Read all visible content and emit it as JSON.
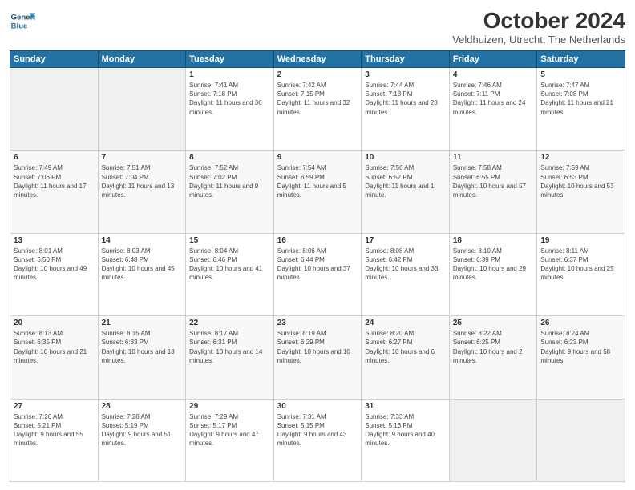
{
  "header": {
    "logo_line1": "General",
    "logo_line2": "Blue",
    "month": "October 2024",
    "location": "Veldhuizen, Utrecht, The Netherlands"
  },
  "weekdays": [
    "Sunday",
    "Monday",
    "Tuesday",
    "Wednesday",
    "Thursday",
    "Friday",
    "Saturday"
  ],
  "weeks": [
    [
      {
        "day": "",
        "sunrise": "",
        "sunset": "",
        "daylight": ""
      },
      {
        "day": "",
        "sunrise": "",
        "sunset": "",
        "daylight": ""
      },
      {
        "day": "1",
        "sunrise": "Sunrise: 7:41 AM",
        "sunset": "Sunset: 7:18 PM",
        "daylight": "Daylight: 11 hours and 36 minutes."
      },
      {
        "day": "2",
        "sunrise": "Sunrise: 7:42 AM",
        "sunset": "Sunset: 7:15 PM",
        "daylight": "Daylight: 11 hours and 32 minutes."
      },
      {
        "day": "3",
        "sunrise": "Sunrise: 7:44 AM",
        "sunset": "Sunset: 7:13 PM",
        "daylight": "Daylight: 11 hours and 28 minutes."
      },
      {
        "day": "4",
        "sunrise": "Sunrise: 7:46 AM",
        "sunset": "Sunset: 7:11 PM",
        "daylight": "Daylight: 11 hours and 24 minutes."
      },
      {
        "day": "5",
        "sunrise": "Sunrise: 7:47 AM",
        "sunset": "Sunset: 7:08 PM",
        "daylight": "Daylight: 11 hours and 21 minutes."
      }
    ],
    [
      {
        "day": "6",
        "sunrise": "Sunrise: 7:49 AM",
        "sunset": "Sunset: 7:06 PM",
        "daylight": "Daylight: 11 hours and 17 minutes."
      },
      {
        "day": "7",
        "sunrise": "Sunrise: 7:51 AM",
        "sunset": "Sunset: 7:04 PM",
        "daylight": "Daylight: 11 hours and 13 minutes."
      },
      {
        "day": "8",
        "sunrise": "Sunrise: 7:52 AM",
        "sunset": "Sunset: 7:02 PM",
        "daylight": "Daylight: 11 hours and 9 minutes."
      },
      {
        "day": "9",
        "sunrise": "Sunrise: 7:54 AM",
        "sunset": "Sunset: 6:59 PM",
        "daylight": "Daylight: 11 hours and 5 minutes."
      },
      {
        "day": "10",
        "sunrise": "Sunrise: 7:56 AM",
        "sunset": "Sunset: 6:57 PM",
        "daylight": "Daylight: 11 hours and 1 minute."
      },
      {
        "day": "11",
        "sunrise": "Sunrise: 7:58 AM",
        "sunset": "Sunset: 6:55 PM",
        "daylight": "Daylight: 10 hours and 57 minutes."
      },
      {
        "day": "12",
        "sunrise": "Sunrise: 7:59 AM",
        "sunset": "Sunset: 6:53 PM",
        "daylight": "Daylight: 10 hours and 53 minutes."
      }
    ],
    [
      {
        "day": "13",
        "sunrise": "Sunrise: 8:01 AM",
        "sunset": "Sunset: 6:50 PM",
        "daylight": "Daylight: 10 hours and 49 minutes."
      },
      {
        "day": "14",
        "sunrise": "Sunrise: 8:03 AM",
        "sunset": "Sunset: 6:48 PM",
        "daylight": "Daylight: 10 hours and 45 minutes."
      },
      {
        "day": "15",
        "sunrise": "Sunrise: 8:04 AM",
        "sunset": "Sunset: 6:46 PM",
        "daylight": "Daylight: 10 hours and 41 minutes."
      },
      {
        "day": "16",
        "sunrise": "Sunrise: 8:06 AM",
        "sunset": "Sunset: 6:44 PM",
        "daylight": "Daylight: 10 hours and 37 minutes."
      },
      {
        "day": "17",
        "sunrise": "Sunrise: 8:08 AM",
        "sunset": "Sunset: 6:42 PM",
        "daylight": "Daylight: 10 hours and 33 minutes."
      },
      {
        "day": "18",
        "sunrise": "Sunrise: 8:10 AM",
        "sunset": "Sunset: 6:39 PM",
        "daylight": "Daylight: 10 hours and 29 minutes."
      },
      {
        "day": "19",
        "sunrise": "Sunrise: 8:11 AM",
        "sunset": "Sunset: 6:37 PM",
        "daylight": "Daylight: 10 hours and 25 minutes."
      }
    ],
    [
      {
        "day": "20",
        "sunrise": "Sunrise: 8:13 AM",
        "sunset": "Sunset: 6:35 PM",
        "daylight": "Daylight: 10 hours and 21 minutes."
      },
      {
        "day": "21",
        "sunrise": "Sunrise: 8:15 AM",
        "sunset": "Sunset: 6:33 PM",
        "daylight": "Daylight: 10 hours and 18 minutes."
      },
      {
        "day": "22",
        "sunrise": "Sunrise: 8:17 AM",
        "sunset": "Sunset: 6:31 PM",
        "daylight": "Daylight: 10 hours and 14 minutes."
      },
      {
        "day": "23",
        "sunrise": "Sunrise: 8:19 AM",
        "sunset": "Sunset: 6:29 PM",
        "daylight": "Daylight: 10 hours and 10 minutes."
      },
      {
        "day": "24",
        "sunrise": "Sunrise: 8:20 AM",
        "sunset": "Sunset: 6:27 PM",
        "daylight": "Daylight: 10 hours and 6 minutes."
      },
      {
        "day": "25",
        "sunrise": "Sunrise: 8:22 AM",
        "sunset": "Sunset: 6:25 PM",
        "daylight": "Daylight: 10 hours and 2 minutes."
      },
      {
        "day": "26",
        "sunrise": "Sunrise: 8:24 AM",
        "sunset": "Sunset: 6:23 PM",
        "daylight": "Daylight: 9 hours and 58 minutes."
      }
    ],
    [
      {
        "day": "27",
        "sunrise": "Sunrise: 7:26 AM",
        "sunset": "Sunset: 5:21 PM",
        "daylight": "Daylight: 9 hours and 55 minutes."
      },
      {
        "day": "28",
        "sunrise": "Sunrise: 7:28 AM",
        "sunset": "Sunset: 5:19 PM",
        "daylight": "Daylight: 9 hours and 51 minutes."
      },
      {
        "day": "29",
        "sunrise": "Sunrise: 7:29 AM",
        "sunset": "Sunset: 5:17 PM",
        "daylight": "Daylight: 9 hours and 47 minutes."
      },
      {
        "day": "30",
        "sunrise": "Sunrise: 7:31 AM",
        "sunset": "Sunset: 5:15 PM",
        "daylight": "Daylight: 9 hours and 43 minutes."
      },
      {
        "day": "31",
        "sunrise": "Sunrise: 7:33 AM",
        "sunset": "Sunset: 5:13 PM",
        "daylight": "Daylight: 9 hours and 40 minutes."
      },
      {
        "day": "",
        "sunrise": "",
        "sunset": "",
        "daylight": ""
      },
      {
        "day": "",
        "sunrise": "",
        "sunset": "",
        "daylight": ""
      }
    ]
  ]
}
